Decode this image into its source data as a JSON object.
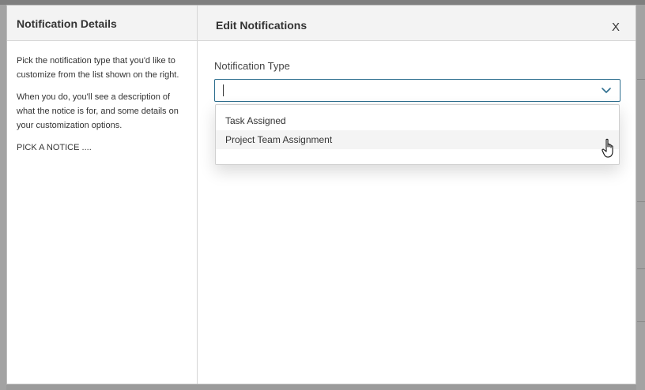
{
  "modal": {
    "left": {
      "title": "Notification Details",
      "paragraphs": [
        "Pick the notification type that you'd like to customize from the list shown on the right.",
        "When you do, you'll see a description of what the notice is for, and some details on your customization options.",
        "PICK A NOTICE ...."
      ]
    },
    "right": {
      "title": "Edit Notifications",
      "close_label": "X",
      "field_label": "Notification Type",
      "select_value": "",
      "options": [
        "Task Assigned",
        "Project Team Assignment"
      ]
    }
  },
  "colors": {
    "select_border": "#2f6f8f",
    "header_bg": "#f3f3f3",
    "option_hover_bg": "#f4f4f4"
  },
  "icons": {
    "chevron": "chevron-down-icon",
    "cursor": "hand-pointer-icon"
  }
}
